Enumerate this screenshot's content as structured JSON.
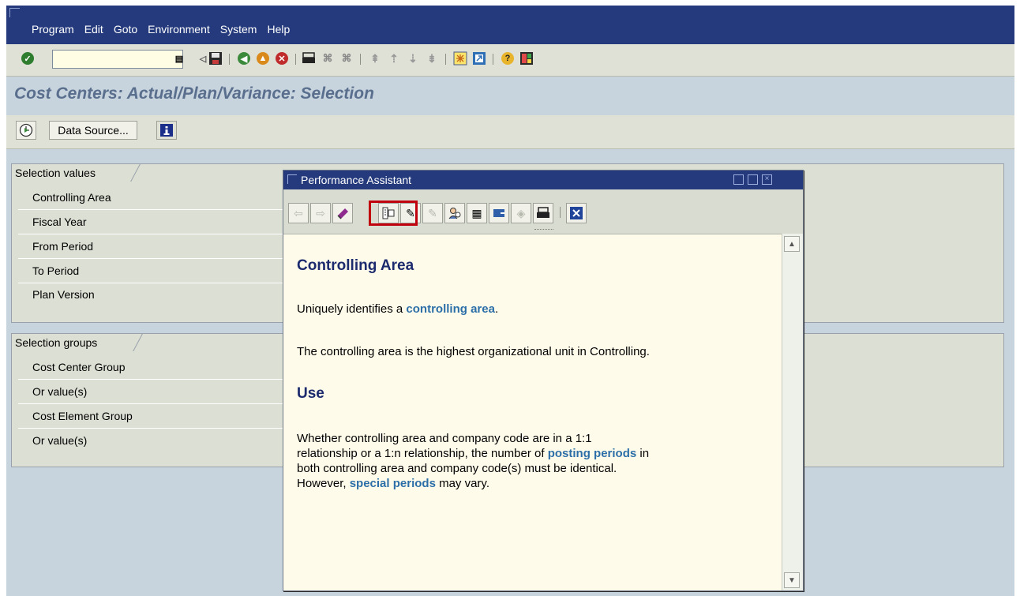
{
  "menu": {
    "items": [
      {
        "label": "Program"
      },
      {
        "label": "Edit"
      },
      {
        "label": "Goto"
      },
      {
        "label": "Environment"
      },
      {
        "label": "System"
      },
      {
        "label": "Help"
      }
    ]
  },
  "title": "Cost Centers: Actual/Plan/Variance: Selection",
  "app_toolbar": {
    "data_source": "Data Source..."
  },
  "selection_values": {
    "header": "Selection values",
    "rows": [
      "Controlling Area",
      "Fiscal Year",
      "From Period",
      "To Period",
      "Plan Version"
    ]
  },
  "selection_groups": {
    "header": "Selection groups",
    "rows": [
      "Cost Center Group",
      "Or value(s)",
      "Cost Element Group",
      "Or value(s)"
    ]
  },
  "assistant": {
    "title": "Performance Assistant",
    "heading": "Controlling Area",
    "p1_pre": "Uniquely identifies a ",
    "p1_link": "controlling area",
    "p1_post": ".",
    "p2": "The controlling area is the highest organizational unit in Controlling.",
    "heading_use": "Use",
    "p3_l1": "Whether controlling area and company code are in a 1:1",
    "p3_l2_pre": "relationship or a 1:n relationship, the number of ",
    "p3_l2_link": "posting periods",
    "p3_l2_post": " in",
    "p3_l3": "both controlling area and company code(s) must be identical.",
    "p3_l4_pre": "However, ",
    "p3_l4_link": "special periods",
    "p3_l4_post": " may vary."
  }
}
